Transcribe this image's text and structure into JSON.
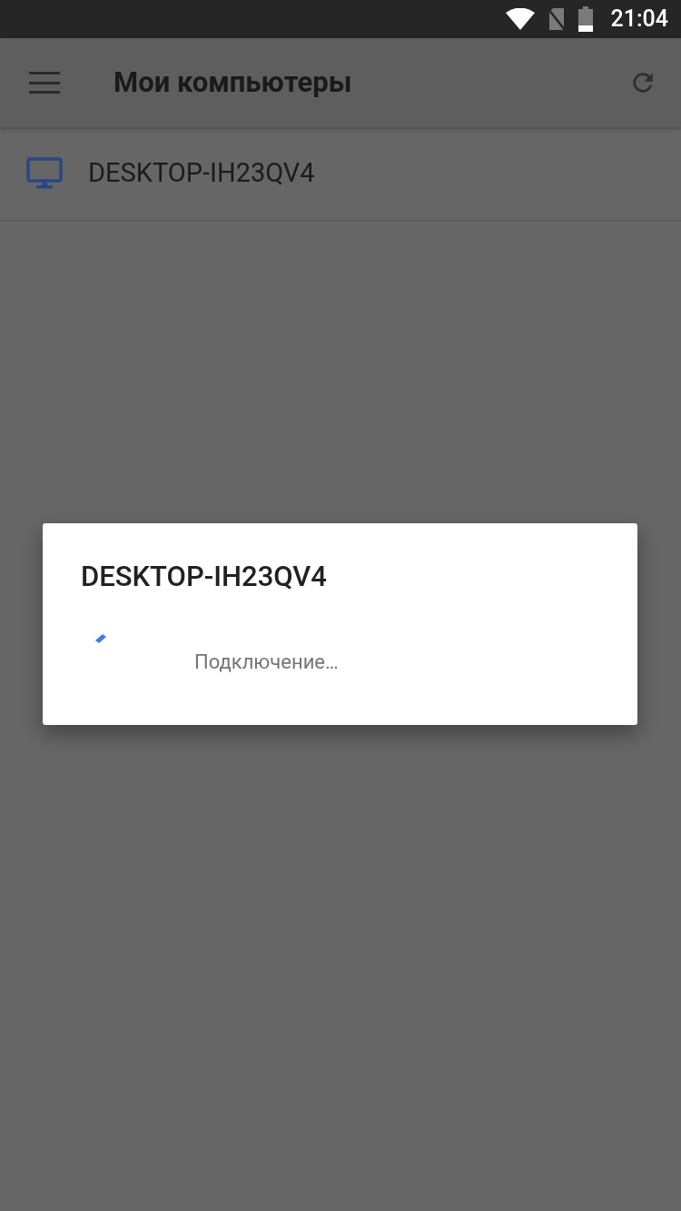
{
  "status_bar": {
    "time": "21:04"
  },
  "app_bar": {
    "title": "Мои компьютеры"
  },
  "computers": [
    {
      "name": "DESKTOP-IH23QV4"
    }
  ],
  "dialog": {
    "title": "DESKTOP-IH23QV4",
    "message": "Подключение…"
  }
}
